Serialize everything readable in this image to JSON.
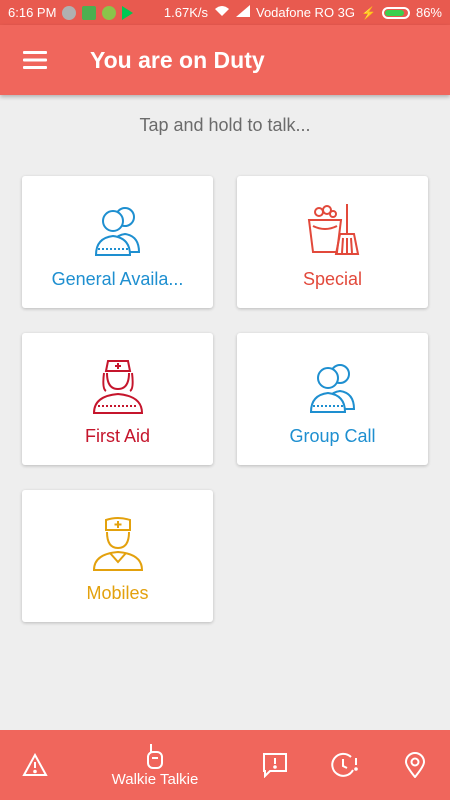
{
  "status_bar": {
    "time": "6:16 PM",
    "speed": "1.67K/s",
    "carrier": "Vodafone RO 3G",
    "battery": "86%"
  },
  "app_bar": {
    "title": "You are on Duty",
    "menu_icon": "hamburger-menu-icon"
  },
  "hint": "Tap and hold to talk...",
  "channels": [
    {
      "label": "General Availa...",
      "icon": "people-icon",
      "color": "#1e8fd0"
    },
    {
      "label": "Special",
      "icon": "cleaning-bucket-broom-icon",
      "color": "#e2493b"
    },
    {
      "label": "First Aid",
      "icon": "nurse-icon",
      "color": "#c5152c"
    },
    {
      "label": "Group Call",
      "icon": "people-icon",
      "color": "#1e8fd0"
    },
    {
      "label": "Mobiles",
      "icon": "doctor-icon",
      "color": "#e3a10d"
    }
  ],
  "bottom_nav": {
    "walkie_label": "Walkie Talkie",
    "items": [
      "alert-triangle-icon",
      "walkie-talkie-icon",
      "message-alert-icon",
      "clock-alert-icon",
      "location-pin-icon"
    ]
  },
  "colors": {
    "primary": "#f0665c",
    "status_bar": "#e85a4f",
    "background": "#eeeeee"
  }
}
